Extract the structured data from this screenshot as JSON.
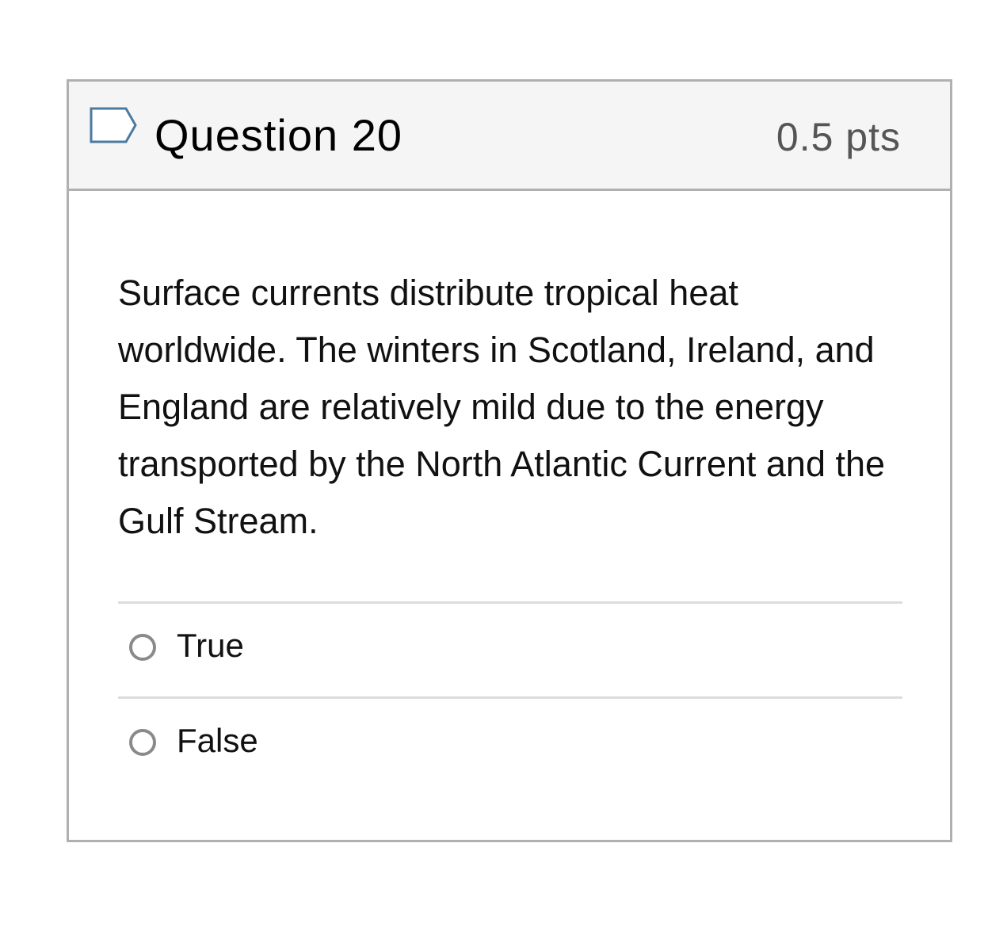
{
  "question": {
    "title": "Question 20",
    "points": "0.5 pts",
    "flag_icon": "flag-outline-icon",
    "text": "Surface currents distribute tropical heat worldwide. The winters in Scotland, Ireland, and England are relatively mild due to the energy transported by the North Atlantic Current and the Gulf Stream."
  },
  "answers": [
    {
      "label": "True"
    },
    {
      "label": "False"
    }
  ],
  "colors": {
    "header_bg": "#f5f5f5",
    "border": "#b0b0b0",
    "flag": "#4a7aa0",
    "radio_border": "#8a8a8a"
  }
}
